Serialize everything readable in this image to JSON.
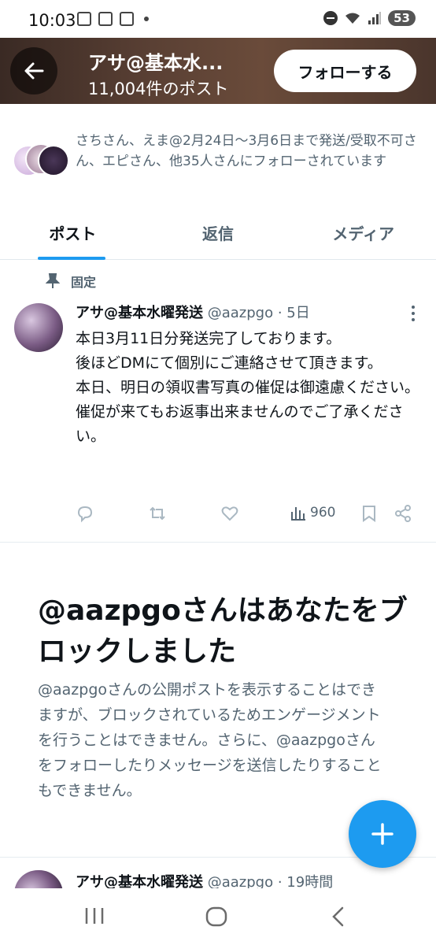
{
  "status_bar": {
    "time": "10:03",
    "battery": "53"
  },
  "header": {
    "title": "アサ@基本水...",
    "post_count": "11,004件のポスト",
    "follow_label": "フォローする",
    "background": "#4a352c"
  },
  "followers": {
    "text": "さちさん、えま@2月24日〜3月6日まで発送/受取不可さん、エピさん、他35人さんにフォローされています"
  },
  "tabs": [
    {
      "label": "ポスト",
      "active": true
    },
    {
      "label": "返信",
      "active": false
    },
    {
      "label": "メディア",
      "active": false
    }
  ],
  "pinned_post": {
    "pinned_label": "固定",
    "author": "アサ@基本水曜発送",
    "handle": "@aazpgo",
    "time": "5日",
    "lines": [
      "本日3月11日分発送完了しております。",
      "後ほどDMにて個別にご連絡させて頂きます。",
      "本日、明日の領収書写真の催促は御遠慮ください。",
      "催促が来てもお返事出来ませんのでご了承ください。"
    ],
    "views": "960"
  },
  "blocked": {
    "title": "@aazpgoさんはあなたをブロックしました",
    "body": "@aazpgoさんの公開ポストを表示することはできますが、ブロックされているためエンゲージメントを行うことはできません。さらに、@aazpgoさんをフォローしたりメッセージを送信したりすることもできません。"
  },
  "next_post": {
    "author": "アサ@基本水曜発送",
    "handle": "@aazpgo",
    "time": "19時間"
  },
  "colors": {
    "accent": "#1d9bf0",
    "secondary_text": "#536471",
    "primary_text": "#0f1419"
  },
  "icons": {
    "back": "arrow-left-icon",
    "pin": "pin-icon",
    "reply": "reply-icon",
    "repost": "repost-icon",
    "like": "heart-icon",
    "views": "views-icon",
    "bookmark": "bookmark-icon",
    "share": "share-icon",
    "compose": "plus-icon"
  }
}
